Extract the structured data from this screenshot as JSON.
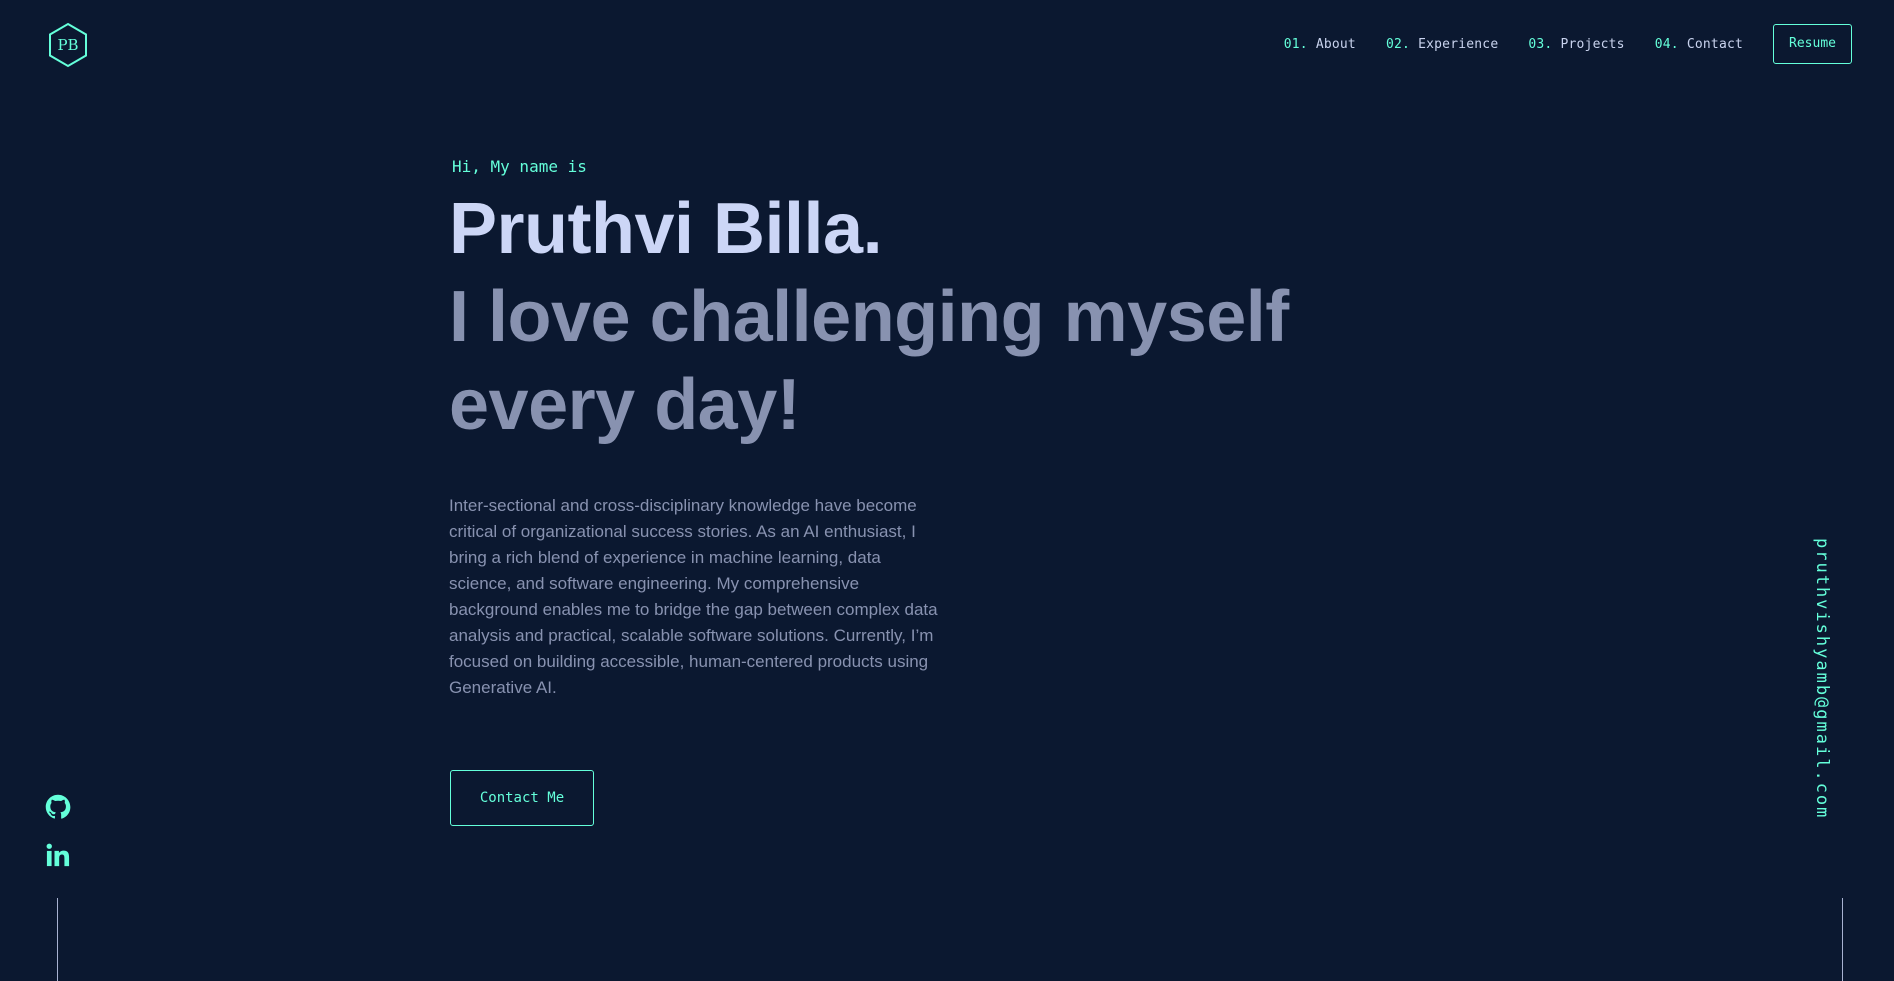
{
  "logo": {
    "text": "PB",
    "icon": "hexagon-logo-icon"
  },
  "nav": {
    "items": [
      {
        "num": "01.",
        "label": "About"
      },
      {
        "num": "02.",
        "label": "Experience"
      },
      {
        "num": "03.",
        "label": "Projects"
      },
      {
        "num": "04.",
        "label": "Contact"
      }
    ],
    "resume_label": "Resume"
  },
  "hero": {
    "greeting": "Hi, My name is",
    "name": "Pruthvi Billa.",
    "tagline": "I love challenging myself every day!",
    "bio": "Inter-sectional and cross-disciplinary knowledge have become critical of organizational success stories. As an AI enthusiast, I bring a rich blend of experience in machine learning, data science, and software engineering. My comprehensive background enables me to bridge the gap between complex data analysis and practical, scalable software solutions. Currently, I’m focused on building accessible, human-centered products using Generative AI.",
    "cta_label": "Contact Me"
  },
  "social": {
    "icons": [
      "github-icon",
      "linkedin-icon"
    ]
  },
  "email": "pruthvishyamb@gmail.com",
  "colors": {
    "background": "#0b1830",
    "accent": "#64ffda",
    "heading": "#ccd6f6",
    "muted": "#8892b0"
  }
}
